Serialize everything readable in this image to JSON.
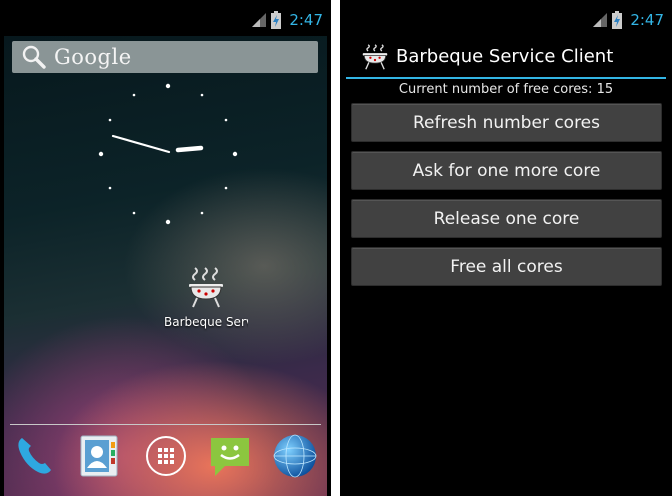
{
  "status_bar": {
    "time": "2:47"
  },
  "home": {
    "search": {
      "label": "Google"
    },
    "app": {
      "label": "Barbeque Serv",
      "icon": "bbq-grill-icon"
    },
    "dock": [
      {
        "name": "phone",
        "icon": "phone-icon"
      },
      {
        "name": "contacts",
        "icon": "contacts-icon"
      },
      {
        "name": "all-apps",
        "icon": "apps-grid-icon"
      },
      {
        "name": "messaging",
        "icon": "messaging-icon"
      },
      {
        "name": "browser",
        "icon": "globe-icon"
      }
    ]
  },
  "app_screen": {
    "title": "Barbeque Service Client",
    "free_cores_text": "Current number of free cores: 15",
    "buttons": {
      "refresh": "Refresh number cores",
      "ask_more": "Ask for one more core",
      "release": "Release one core",
      "free_all": "Free all cores"
    }
  },
  "colors": {
    "accent": "#33b5e5",
    "button_bg": "#414141",
    "search_bg": "#8a9596"
  }
}
